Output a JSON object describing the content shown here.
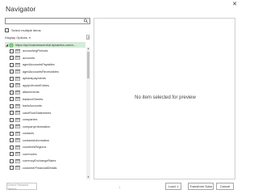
{
  "window": {
    "title": "Navigator",
    "close_glyph": "✕"
  },
  "search": {
    "value": "",
    "placeholder": ""
  },
  "multi_select": {
    "label": "Select multiple items",
    "checked": false
  },
  "display_options": {
    "label": "Display Options",
    "chevron": "▾"
  },
  "tree": {
    "root": {
      "label": "https://api.businesscentral.dynamics.com/v...",
      "caret": "◢"
    },
    "items": [
      "accountingPeriods",
      "accounts",
      "agedAccountsPayables",
      "agedAccountsReceivables",
      "apbankpayments",
      "applyVendorEntries",
      "attachments",
      "balanceSheets",
      "bankAccounts",
      "cashFlowStatements",
      "companies",
      "companyInformation",
      "contacts",
      "contactsInformation",
      "countriesRegions",
      "currencies",
      "currencyExchangeRates",
      "customerFinancialDetails"
    ]
  },
  "preview": {
    "message": "No item selected for preview"
  },
  "footer": {
    "select_related": "Select Related Tables",
    "load": "Load",
    "load_chevron": "▾",
    "transform": "Transform Data",
    "cancel": "Cancel",
    "resize_glyph": "⁞"
  },
  "colors": {
    "selected_root_bg": "#d6ecd7",
    "accent_green": "#3a9a44"
  }
}
